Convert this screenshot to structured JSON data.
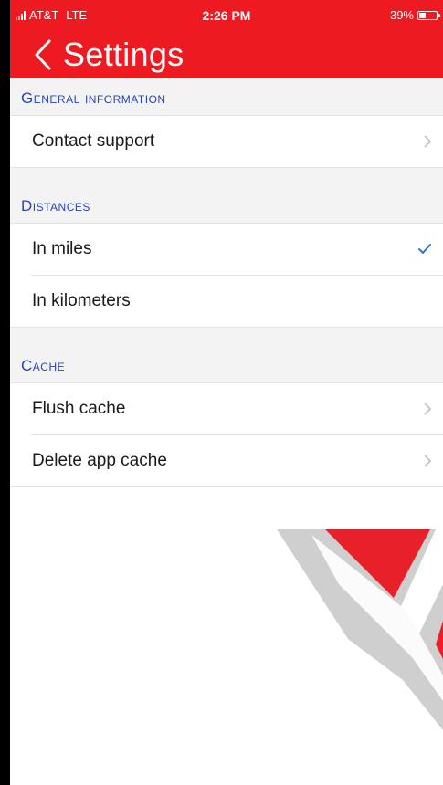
{
  "status_bar": {
    "carrier": "AT&T",
    "network": "LTE",
    "time": "2:26 PM",
    "battery": "39%",
    "battery_level": 0.39
  },
  "nav": {
    "back_icon": "chevron-left-icon",
    "title": "Settings"
  },
  "sections": {
    "general": {
      "header": "General information",
      "items": [
        {
          "label": "Contact support",
          "accessory": "chevron-right-icon"
        }
      ]
    },
    "distances": {
      "header": "Distances",
      "items": [
        {
          "label": "In miles",
          "accessory": "checkmark-icon",
          "selected": true
        },
        {
          "label": "In kilometers",
          "accessory": "",
          "selected": false
        }
      ]
    },
    "cache": {
      "header": "Cache",
      "items": [
        {
          "label": "Flush cache",
          "accessory": "chevron-right-icon"
        },
        {
          "label": "Delete app cache",
          "accessory": "chevron-right-icon"
        }
      ]
    }
  },
  "colors": {
    "brand_red": "#ee1a22",
    "section_blue": "#2a45b8",
    "check_blue": "#2b74e0",
    "logo_gray": "#cfcfcf"
  }
}
